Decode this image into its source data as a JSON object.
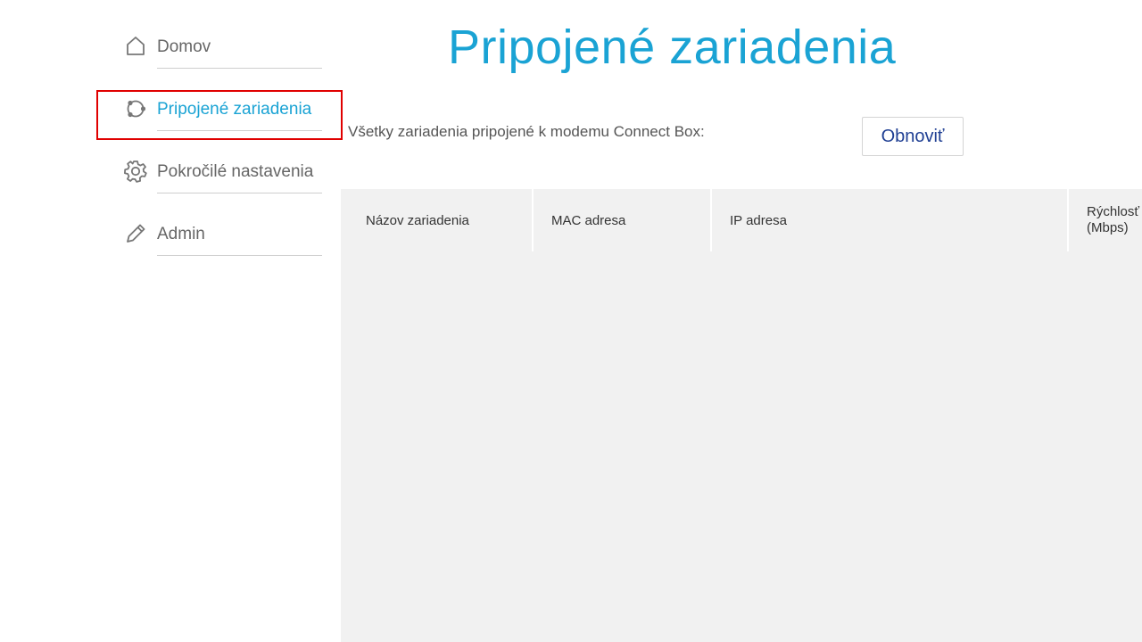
{
  "sidebar": {
    "items": [
      {
        "label": "Domov",
        "icon": "home-icon"
      },
      {
        "label": "Pripojené zariadenia",
        "icon": "connected-devices-icon",
        "active": true
      },
      {
        "label": "Pokročilé nastavenia",
        "icon": "gear-icon"
      },
      {
        "label": "Admin",
        "icon": "pencil-icon"
      }
    ]
  },
  "main": {
    "title": "Pripojené zariadenia",
    "subtitle": "Všetky zariadenia pripojené k modemu Connect Box:",
    "refresh_label": "Obnoviť"
  },
  "table": {
    "columns": [
      "Názov zariadenia",
      "MAC adresa",
      "IP adresa",
      "Rýchlosť\n(Mbps)"
    ],
    "rows": []
  },
  "colors": {
    "accent": "#1aa3d4",
    "button_text": "#1f3f93",
    "focus_outline": "#e00000",
    "table_bg": "#f1f1f1"
  }
}
